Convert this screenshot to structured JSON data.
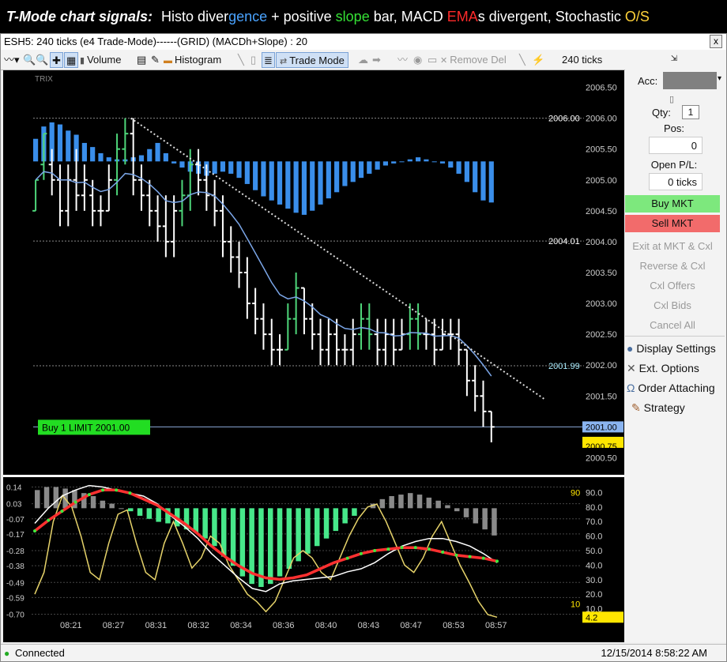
{
  "banner": {
    "lead": "T-Mode chart signals:",
    "p1": "Histo diver",
    "p2": "gence",
    "p3": " + positive ",
    "p4": "slope",
    "p5": " bar, MACD ",
    "p6": "EMA",
    "p7": "s divergent, Stochastic ",
    "p8": "O/S",
    "colors": {
      "white": "#ffffff",
      "blue": "#4aa3ff",
      "green": "#35e035",
      "red": "#ff2a2a",
      "yellow": "#ffd23a"
    }
  },
  "window": {
    "title": "ESH5: 240 ticks (e4 Trade-Mode)------(GRID) (MACDh+Slope) : 20",
    "close_label": "x"
  },
  "toolbar": {
    "volume": "Volume",
    "histogram": "Histogram",
    "trade_mode": "Trade Mode",
    "remove_del": "Remove Del",
    "ticks": "240 ticks",
    "dropdown": "▾"
  },
  "panel": {
    "acc_label": "Acc:",
    "qty_label": "Qty:",
    "qty_value": "1",
    "pos_label": "Pos:",
    "pos_value": "0",
    "pl_label": "Open P/L:",
    "pl_value": "0 ticks",
    "buy": "Buy MKT",
    "sell": "Sell MKT",
    "exit": "Exit at MKT & Cxl",
    "reverse": "Reverse & Cxl",
    "cxl_offers": "Cxl Offers",
    "cxl_bids": "Cxl Bids",
    "cancel_all": "Cancel All",
    "display_settings": "Display Settings",
    "ext_options": "Ext. Options",
    "order_attaching": "Order Attaching",
    "strategy": "Strategy",
    "buy_color": "#7de87d",
    "sell_color": "#f26b6b"
  },
  "status": {
    "connected": "Connected",
    "datetime": "12/15/2014 8:58:22 AM"
  },
  "chart_data": [
    {
      "type": "price",
      "indicator_label": "TRIX",
      "y_ticks": [
        "2006.50",
        "2006.00",
        "2005.50",
        "2005.00",
        "2004.50",
        "2004.00",
        "2003.50",
        "2003.00",
        "2002.50",
        "2002.00",
        "2001.50",
        "2001.00",
        "2000.50"
      ],
      "ylim": [
        2000.25,
        2006.75
      ],
      "price_labels": [
        {
          "text": "2006.00",
          "value": 2006.0
        },
        {
          "text": "2004.01",
          "value": 2004.01
        },
        {
          "text": "2001.99",
          "value": 2001.99
        },
        {
          "text": "2001.00",
          "value": 2001.0
        },
        {
          "text": "2000.75",
          "value": 2000.75
        }
      ],
      "order_label": "Buy 1 LIMIT 2001.00",
      "bars": [
        [
          2004.5,
          2005.0,
          2004.5,
          2005.0
        ],
        [
          2005.25,
          2005.75,
          2005.0,
          2005.75
        ],
        [
          2005.25,
          2005.5,
          2004.75,
          2005.0
        ],
        [
          2005.0,
          2005.25,
          2004.25,
          2004.5
        ],
        [
          2004.5,
          2005.25,
          2004.25,
          2005.0
        ],
        [
          2005.0,
          2005.5,
          2004.5,
          2004.75
        ],
        [
          2004.75,
          2005.25,
          2004.5,
          2005.0
        ],
        [
          2004.75,
          2005.0,
          2004.25,
          2004.5
        ],
        [
          2004.5,
          2004.75,
          2004.25,
          2004.5
        ],
        [
          2004.5,
          2005.25,
          2004.5,
          2005.0
        ],
        [
          2005.0,
          2005.75,
          2004.75,
          2005.5
        ],
        [
          2005.5,
          2006.0,
          2005.25,
          2005.75
        ],
        [
          2005.75,
          2006.0,
          2004.75,
          2005.0
        ],
        [
          2005.0,
          2005.25,
          2004.5,
          2004.75
        ],
        [
          2004.75,
          2005.0,
          2004.25,
          2004.5
        ],
        [
          2004.5,
          2004.75,
          2004.0,
          2004.25
        ],
        [
          2004.25,
          2004.75,
          2003.75,
          2004.0
        ],
        [
          2004.0,
          2004.75,
          2003.75,
          2004.5
        ],
        [
          2004.5,
          2005.0,
          2004.25,
          2004.75
        ],
        [
          2004.75,
          2005.5,
          2004.5,
          2005.25
        ],
        [
          2005.25,
          2005.5,
          2004.75,
          2005.0
        ],
        [
          2005.0,
          2005.25,
          2004.5,
          2004.75
        ],
        [
          2004.75,
          2005.0,
          2004.25,
          2004.5
        ],
        [
          2004.5,
          2004.75,
          2003.75,
          2004.0
        ],
        [
          2004.0,
          2004.25,
          2003.5,
          2003.75
        ],
        [
          2003.75,
          2004.0,
          2003.25,
          2003.5
        ],
        [
          2003.5,
          2003.75,
          2002.75,
          2003.0
        ],
        [
          2003.0,
          2003.25,
          2002.5,
          2002.75
        ],
        [
          2002.75,
          2003.0,
          2002.25,
          2002.5
        ],
        [
          2002.5,
          2002.75,
          2002.0,
          2002.25
        ],
        [
          2002.25,
          2002.5,
          2002.0,
          2002.25
        ],
        [
          2002.25,
          2003.0,
          2002.25,
          2002.75
        ],
        [
          2002.75,
          2003.5,
          2002.5,
          2003.25
        ],
        [
          2003.25,
          2003.25,
          2002.5,
          2002.75
        ],
        [
          2002.75,
          2003.0,
          2002.25,
          2002.5
        ],
        [
          2002.5,
          2002.75,
          2002.0,
          2002.25
        ],
        [
          2002.25,
          2002.75,
          2002.0,
          2002.5
        ],
        [
          2002.5,
          2002.75,
          2002.0,
          2002.25
        ],
        [
          2002.25,
          2002.5,
          2002.0,
          2002.25
        ],
        [
          2002.25,
          2002.75,
          2002.0,
          2002.5
        ],
        [
          2002.5,
          2003.0,
          2002.25,
          2002.75
        ],
        [
          2002.75,
          2003.0,
          2002.25,
          2002.5
        ],
        [
          2002.5,
          2002.75,
          2002.0,
          2002.25
        ],
        [
          2002.25,
          2002.75,
          2002.0,
          2002.5
        ],
        [
          2002.5,
          2002.75,
          2002.0,
          2002.25
        ],
        [
          2002.25,
          2002.75,
          2002.25,
          2002.5
        ],
        [
          2002.5,
          2003.0,
          2002.25,
          2002.75
        ],
        [
          2002.75,
          2003.0,
          2002.25,
          2002.5
        ],
        [
          2002.5,
          2002.75,
          2002.25,
          2002.5
        ],
        [
          2002.5,
          2002.75,
          2002.0,
          2002.25
        ],
        [
          2002.25,
          2002.75,
          2002.25,
          2002.5
        ],
        [
          2002.5,
          2002.75,
          2002.25,
          2002.5
        ],
        [
          2002.5,
          2002.75,
          2002.0,
          2002.25
        ],
        [
          2002.25,
          2002.25,
          2001.5,
          2001.75
        ],
        [
          2001.75,
          2002.0,
          2001.25,
          2001.5
        ],
        [
          2001.5,
          2001.75,
          2001.0,
          2001.25
        ],
        [
          2001.25,
          2001.25,
          2000.75,
          2001.0
        ]
      ],
      "trix_histogram": [
        0.55,
        0.85,
        0.95,
        0.9,
        0.75,
        0.65,
        0.45,
        0.35,
        0.2,
        0.1,
        0.05,
        0.05,
        0.1,
        0.15,
        0.3,
        0.45,
        0.2,
        -0.05,
        -0.15,
        -0.25,
        -0.3,
        -0.35,
        -0.3,
        -0.25,
        -0.3,
        -0.4,
        -0.55,
        -0.7,
        -0.85,
        -0.95,
        -1.05,
        -1.15,
        -1.25,
        -1.3,
        -1.2,
        -1.05,
        -0.9,
        -0.75,
        -0.6,
        -0.5,
        -0.4,
        -0.3,
        -0.2,
        -0.1,
        -0.05,
        0.0,
        0.05,
        0.1,
        0.05,
        0.0,
        -0.05,
        -0.15,
        -0.3,
        -0.5,
        -0.75,
        -0.95,
        -1.0
      ]
    },
    {
      "type": "macd_stochastic",
      "left_ticks": [
        "0.14",
        "0.03",
        "-0.07",
        "-0.17",
        "-0.28",
        "-0.38",
        "-0.49",
        "-0.59",
        "-0.70"
      ],
      "right_ticks": [
        "90.0",
        "80.0",
        "70.0",
        "60.0",
        "50.0",
        "40.0",
        "30.0",
        "20.0",
        "10.0"
      ],
      "level_labels": {
        "upper": "90",
        "lower": "10",
        "current": "4.2"
      },
      "x_labels": [
        "08:21",
        "08:27",
        "08:31",
        "08:32",
        "08:34",
        "08:36",
        "08:40",
        "08:43",
        "08:47",
        "08:53",
        "08:57"
      ],
      "macd_hist": [
        0.12,
        0.14,
        0.14,
        0.13,
        0.12,
        0.1,
        0.08,
        0.05,
        0.03,
        0.0,
        -0.02,
        -0.05,
        -0.07,
        -0.09,
        -0.1,
        -0.12,
        -0.14,
        -0.16,
        -0.2,
        -0.25,
        -0.32,
        -0.38,
        -0.45,
        -0.5,
        -0.52,
        -0.5,
        -0.45,
        -0.4,
        -0.35,
        -0.3,
        -0.25,
        -0.2,
        -0.15,
        -0.1,
        -0.05,
        0.0,
        0.03,
        0.06,
        0.08,
        0.09,
        0.1,
        0.09,
        0.07,
        0.05,
        0.02,
        -0.02,
        -0.06,
        -0.1,
        -0.14,
        -0.18
      ],
      "macd_line": [
        -0.1,
        0.0,
        0.08,
        0.12,
        0.15,
        0.14,
        0.12,
        0.1,
        0.08,
        0.03,
        -0.05,
        -0.12,
        -0.2,
        -0.3,
        -0.38,
        -0.46,
        -0.53,
        -0.55,
        -0.5,
        -0.48,
        -0.47,
        -0.46,
        -0.45,
        -0.42,
        -0.4,
        -0.36,
        -0.3,
        -0.25,
        -0.22,
        -0.2,
        -0.2,
        -0.22,
        -0.25,
        -0.3,
        -0.36
      ],
      "signal_line": [
        -0.15,
        -0.08,
        -0.02,
        0.04,
        0.09,
        0.12,
        0.12,
        0.1,
        0.06,
        0.02,
        -0.04,
        -0.1,
        -0.17,
        -0.25,
        -0.32,
        -0.38,
        -0.43,
        -0.46,
        -0.47,
        -0.46,
        -0.44,
        -0.4,
        -0.36,
        -0.33,
        -0.3,
        -0.28,
        -0.27,
        -0.26,
        -0.26,
        -0.27,
        -0.29,
        -0.31,
        -0.32,
        -0.33,
        -0.35
      ],
      "stochastic": [
        20,
        35,
        70,
        88,
        80,
        60,
        35,
        30,
        55,
        75,
        78,
        55,
        35,
        30,
        55,
        70,
        55,
        38,
        45,
        60,
        55,
        40,
        30,
        20,
        15,
        8,
        15,
        30,
        45,
        50,
        45,
        35,
        30,
        45,
        60,
        72,
        80,
        82,
        70,
        55,
        40,
        35,
        45,
        60,
        70,
        55,
        40,
        28,
        15,
        6,
        4.2
      ]
    }
  ]
}
